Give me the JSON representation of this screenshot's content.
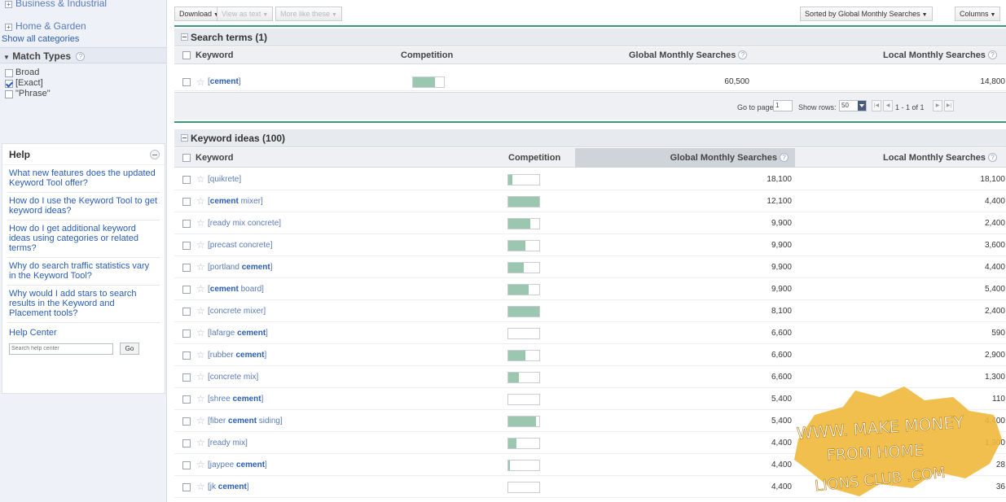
{
  "sidebar": {
    "categories": [
      {
        "label": "Business & Industrial"
      },
      {
        "label": "Home & Garden"
      }
    ],
    "show_all": "Show all categories",
    "match_types": {
      "title": "Match Types",
      "items": [
        {
          "label": "Broad",
          "checked": false
        },
        {
          "label": "[Exact]",
          "checked": true
        },
        {
          "label": "\"Phrase\"",
          "checked": false
        }
      ]
    },
    "help": {
      "title": "Help",
      "links": [
        "What new features does the updated Keyword Tool offer?",
        "How do I use the Keyword Tool to get keyword ideas?",
        "How do I get additional keyword ideas using categories or related terms?",
        "Why do search traffic statistics vary in the Keyword Tool?",
        "Why would I add stars to search results in the Keyword and Placement tools?"
      ],
      "help_center": "Help Center",
      "search_placeholder": "Search help center",
      "go_label": "Go"
    }
  },
  "toolbar": {
    "download": "Download",
    "view_as_text": "View as text",
    "more_like_these": "More like these",
    "sorted_by": "Sorted by Global Monthly Searches",
    "columns": "Columns"
  },
  "search_terms": {
    "title": "Search terms (1)",
    "headers": {
      "keyword": "Keyword",
      "competition": "Competition",
      "global": "Global Monthly Searches",
      "local": "Local Monthly Searches"
    },
    "rows": [
      {
        "pre": "[",
        "bold": "cement",
        "post": "]",
        "competition": 0.7,
        "global": "60,500",
        "local": "14,800"
      }
    ]
  },
  "pager": {
    "go_to_page": "Go to page:",
    "page": "1",
    "show_rows": "Show rows:",
    "rows": "50",
    "range": "1 - 1 of 1"
  },
  "keyword_ideas": {
    "title": "Keyword ideas (100)",
    "headers": {
      "keyword": "Keyword",
      "competition": "Competition",
      "global": "Global Monthly Searches",
      "local": "Local Monthly Searches"
    },
    "rows": [
      {
        "pre": "[quikrete]",
        "bold": "",
        "post": "",
        "competition": 0.12,
        "global": "18,100",
        "local": "18,100"
      },
      {
        "pre": "[",
        "bold": "cement",
        "post": " mixer]",
        "competition": 1.0,
        "global": "12,100",
        "local": "4,400"
      },
      {
        "pre": "[ready mix concrete]",
        "bold": "",
        "post": "",
        "competition": 0.7,
        "global": "9,900",
        "local": "2,400"
      },
      {
        "pre": "[precast concrete]",
        "bold": "",
        "post": "",
        "competition": 0.55,
        "global": "9,900",
        "local": "3,600"
      },
      {
        "pre": "[portland ",
        "bold": "cement",
        "post": "]",
        "competition": 0.5,
        "global": "9,900",
        "local": "4,400"
      },
      {
        "pre": "[",
        "bold": "cement",
        "post": " board]",
        "competition": 0.65,
        "global": "9,900",
        "local": "5,400"
      },
      {
        "pre": "[concrete mixer]",
        "bold": "",
        "post": "",
        "competition": 1.0,
        "global": "8,100",
        "local": "2,400"
      },
      {
        "pre": "[lafarge ",
        "bold": "cement",
        "post": "]",
        "competition": 0.0,
        "global": "6,600",
        "local": "590"
      },
      {
        "pre": "[rubber ",
        "bold": "cement",
        "post": "]",
        "competition": 0.55,
        "global": "6,600",
        "local": "2,900"
      },
      {
        "pre": "[concrete mix]",
        "bold": "",
        "post": "",
        "competition": 0.35,
        "global": "6,600",
        "local": "1,300"
      },
      {
        "pre": "[shree ",
        "bold": "cement",
        "post": "]",
        "competition": 0.0,
        "global": "5,400",
        "local": "110"
      },
      {
        "pre": "[fiber ",
        "bold": "cement",
        "post": " siding]",
        "competition": 0.9,
        "global": "5,400",
        "local": "4,400"
      },
      {
        "pre": "[ready mix]",
        "bold": "",
        "post": "",
        "competition": 0.25,
        "global": "4,400",
        "local": "1,300"
      },
      {
        "pre": "[jaypee ",
        "bold": "cement",
        "post": "]",
        "competition": 0.05,
        "global": "4,400",
        "local": "28"
      },
      {
        "pre": "[jk ",
        "bold": "cement",
        "post": "]",
        "competition": 0.0,
        "global": "4,400",
        "local": "36"
      }
    ]
  },
  "watermark": {
    "line1": "WWW. MAKE MONEY",
    "line2": "FROM HOME",
    "line3": "LIONS CLUB .COM"
  },
  "colors": {
    "accent_green": "#3b9a76",
    "competition_fill": "#9bc7b0",
    "link_blue": "#2a5db0",
    "watermark_gold": "#f0b83a"
  }
}
